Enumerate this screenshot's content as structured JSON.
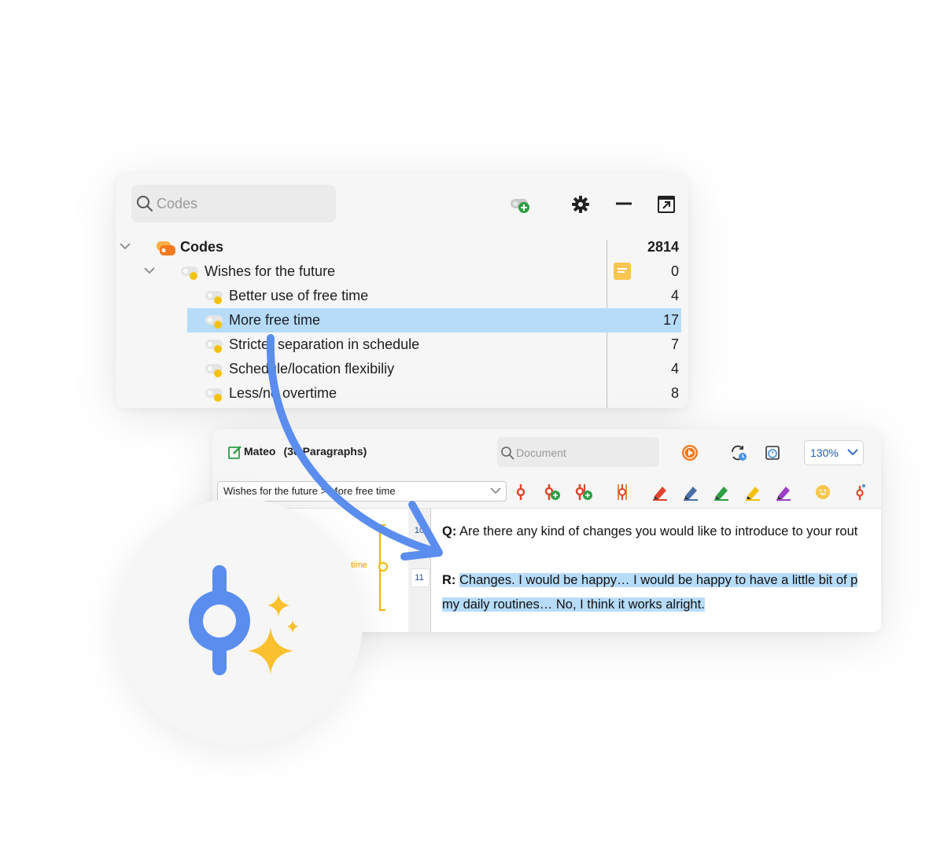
{
  "codes_panel": {
    "search_placeholder": "Codes",
    "toolbar": {
      "new_code_icon": "new-code-icon",
      "settings_icon": "gear-icon",
      "minimize_icon": "minus-icon",
      "undock_icon": "undock-icon"
    },
    "tree": [
      {
        "label": "Codes",
        "count": "2814",
        "level": 0,
        "bold": true
      },
      {
        "label": "Wishes for the future",
        "count": "0",
        "level": 1,
        "memo": true
      },
      {
        "label": "Better use of free time",
        "count": "4",
        "level": 2
      },
      {
        "label": "More free time",
        "count": "17",
        "level": 2,
        "selected": true
      },
      {
        "label": "Stricter separation in schedule",
        "count": "7",
        "level": 2
      },
      {
        "label": "Schedule/location flexibiliy",
        "count": "4",
        "level": 2
      },
      {
        "label": "Less/no overtime",
        "count": "8",
        "level": 2
      }
    ]
  },
  "document_panel": {
    "doc_name": "Mateo",
    "paragraphs_label": "(36 Paragraphs)",
    "search_placeholder": "Document",
    "zoom": "130%",
    "code_path": "Wishes for the future > More free time",
    "code_tag": "time",
    "paragraph_numbers": [
      "10",
      "11"
    ],
    "q_speaker": "Q:",
    "q_text": "Are there any kind of changes you would like to introduce to your rout",
    "r_speaker": "R:",
    "r_text_1": "Changes. I would be happy… I would be happy to have a little bit of p",
    "r_text_2": "my daily routines… No, I think it works alright."
  },
  "colors": {
    "selection": "#b7dcfa",
    "accent_blue": "#5b8def",
    "code_yellow": "#f4b400",
    "sparkle": "#fbc02d",
    "orange": "#f47a20"
  },
  "badge": {
    "icon": "ai-coding-sparkle-icon"
  }
}
